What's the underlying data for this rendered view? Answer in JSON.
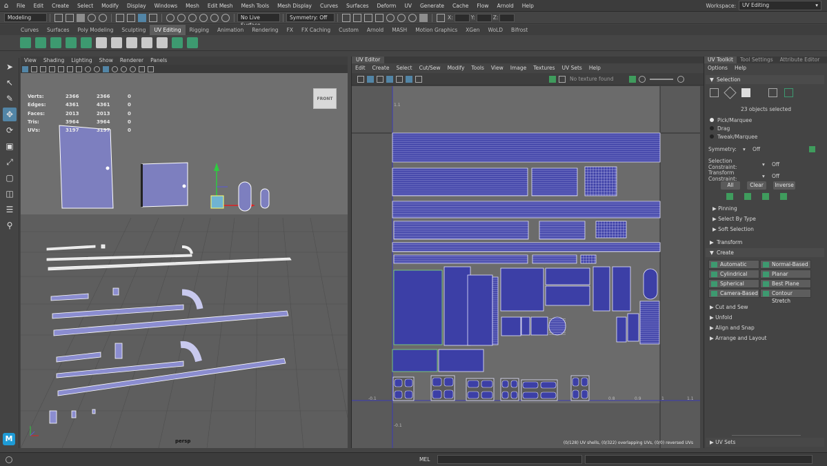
{
  "menubar": {
    "items": [
      "File",
      "Edit",
      "Create",
      "Select",
      "Modify",
      "Display",
      "Windows",
      "Mesh",
      "Edit Mesh",
      "Mesh Tools",
      "Mesh Display",
      "Curves",
      "Surfaces",
      "Deform",
      "UV",
      "Generate",
      "Cache",
      "Flow",
      "Arnold",
      "Help"
    ],
    "workspace_label": "Workspace:",
    "workspace_value": "UV Editing"
  },
  "statusline": {
    "mode": "Modeling",
    "live_surface": "No Live Surface",
    "symmetry": "Symmetry: Off",
    "x_label": "X:",
    "y_label": "Y:",
    "z_label": "Z:"
  },
  "shelf": {
    "tabs": [
      "Curves",
      "Surfaces",
      "Poly Modeling",
      "Sculpting",
      "UV Editing",
      "Rigging",
      "Animation",
      "Rendering",
      "FX",
      "FX Caching",
      "Custom",
      "Arnold",
      "MASH",
      "Motion Graphics",
      "XGen",
      "WoLD",
      "Bifrost"
    ],
    "active_tab": "UV Editing"
  },
  "viewport": {
    "menu": [
      "View",
      "Shading",
      "Lighting",
      "Show",
      "Renderer",
      "Panels"
    ],
    "hud": [
      {
        "label": "Verts:",
        "a": "2366",
        "b": "2366",
        "c": "0"
      },
      {
        "label": "Edges:",
        "a": "4361",
        "b": "4361",
        "c": "0"
      },
      {
        "label": "Faces:",
        "a": "2013",
        "b": "2013",
        "c": "0"
      },
      {
        "label": "Tris:",
        "a": "3964",
        "b": "3964",
        "c": "0"
      },
      {
        "label": "UVs:",
        "a": "3197",
        "b": "3197",
        "c": "0"
      }
    ],
    "viewcube_label": "FRONT",
    "camera_label": "persp"
  },
  "uv_editor": {
    "title": "UV Editor",
    "menu": [
      "Edit",
      "Create",
      "Select",
      "Cut/Sew",
      "Modify",
      "Tools",
      "View",
      "Image",
      "Textures",
      "UV Sets",
      "Help"
    ],
    "texture_status": "No texture found",
    "axis_labels": {
      "u_neg": "-0.1",
      "u_09a": "0.8",
      "u_09b": "0.9",
      "u_1": "1",
      "u_11": "1.1",
      "v_11": "1.1",
      "v_neg": "-0.1"
    },
    "status": "(0/128) UV shells, (0/322) overlapping UVs, (0/0) reversed UVs",
    "colors": {
      "shell_fill": "#3c3fa6",
      "shell_edge": "#e6e6ff",
      "grid_line": "#222222",
      "axis_line": "#3b3bb5"
    }
  },
  "toolkit": {
    "tabs": [
      "UV Toolkit",
      "Tool Settings",
      "Attribute Editor"
    ],
    "menu": [
      "Options",
      "Help"
    ],
    "selection_header": "Selection",
    "objects_selected": "23 objects selected",
    "pick_modes": [
      "Pick/Marquee",
      "Drag",
      "Tweak/Marquee"
    ],
    "symmetry_label": "Symmetry:",
    "symmetry_value": "Off",
    "selection_constraint_label": "Selection Constraint:",
    "selection_constraint_value": "Off",
    "transform_constraint_label": "Transform Constraint:",
    "transform_constraint_value": "Off",
    "buttons": {
      "all": "All",
      "clear": "Clear",
      "inverse": "Inverse"
    },
    "sub_sections": [
      "Pinning",
      "Select By Type",
      "Soft Selection"
    ],
    "transform_header": "Transform",
    "create_header": "Create",
    "create_buttons": [
      "Automatic",
      "Normal-Based",
      "Cylindrical",
      "Planar",
      "Spherical",
      "Best Plane",
      "Camera-Based",
      "Contour Stretch"
    ],
    "more_sections": [
      "Cut and Sew",
      "Unfold",
      "Align and Snap",
      "Arrange and Layout"
    ],
    "uv_sets": "UV Sets"
  },
  "bottom": {
    "mel_label": "MEL"
  }
}
